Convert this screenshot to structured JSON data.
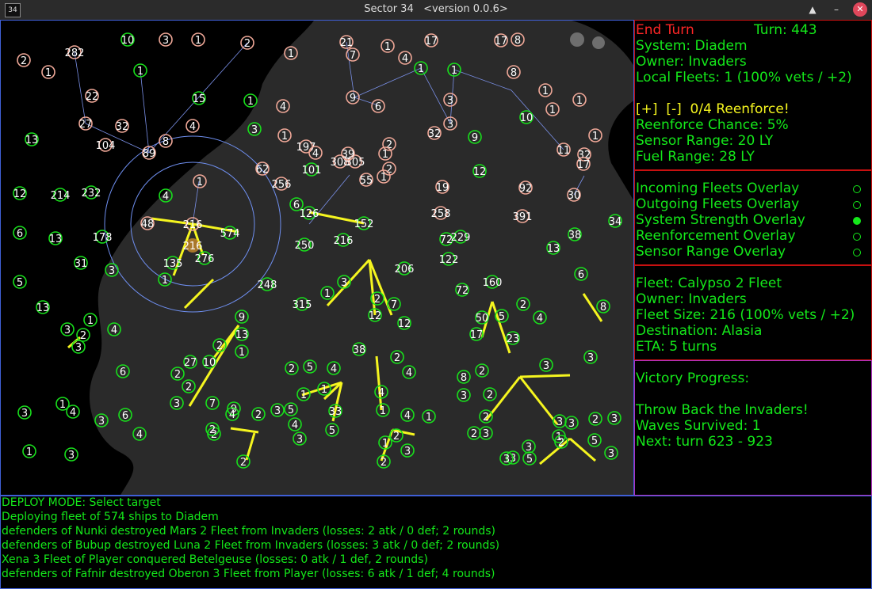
{
  "window": {
    "app_icon": "34",
    "title": "Sector 34",
    "version": "<version 0.0.6>",
    "controls": [
      "restore-icon",
      "minimize-icon",
      "close-icon"
    ]
  },
  "colors": {
    "enemy": "#f0a898",
    "player": "#18e01c",
    "fleet": "#f5f51f",
    "ring": "#6f8ff0",
    "panel_border": "#c81010",
    "text": "#14e81a"
  },
  "stars": [
    {
      "label": "10",
      "side": "player"
    },
    {
      "label": "3",
      "side": "enemy"
    },
    {
      "label": "1",
      "side": "enemy"
    },
    {
      "label": "2",
      "side": "enemy"
    },
    {
      "label": "1",
      "side": "enemy"
    },
    {
      "label": "2",
      "side": "enemy"
    },
    {
      "label": "1",
      "side": "enemy"
    },
    {
      "label": "282",
      "side": "enemy"
    },
    {
      "label": "1",
      "side": "player"
    },
    {
      "label": "21",
      "side": "enemy"
    },
    {
      "label": "1",
      "side": "enemy"
    },
    {
      "label": "17",
      "side": "enemy"
    },
    {
      "label": "1",
      "side": "player"
    },
    {
      "label": "17",
      "side": "enemy"
    },
    {
      "label": "8",
      "side": "enemy"
    },
    {
      "label": "7",
      "side": "enemy"
    },
    {
      "label": "4",
      "side": "enemy"
    },
    {
      "label": "1",
      "side": "player"
    },
    {
      "label": "8",
      "side": "enemy"
    },
    {
      "label": "3",
      "side": "enemy"
    },
    {
      "label": "1",
      "side": "enemy"
    },
    {
      "label": "22",
      "side": "enemy"
    },
    {
      "label": "15",
      "side": "player"
    },
    {
      "label": "1",
      "side": "player"
    },
    {
      "label": "4",
      "side": "enemy"
    },
    {
      "label": "6",
      "side": "enemy"
    },
    {
      "label": "9",
      "side": "enemy"
    },
    {
      "label": "3",
      "side": "enemy"
    },
    {
      "label": "1",
      "side": "enemy"
    },
    {
      "label": "1",
      "side": "enemy"
    },
    {
      "label": "27",
      "side": "enemy"
    },
    {
      "label": "32",
      "side": "enemy"
    },
    {
      "label": "4",
      "side": "enemy"
    },
    {
      "label": "3",
      "side": "player"
    },
    {
      "label": "1",
      "side": "enemy"
    },
    {
      "label": "2",
      "side": "enemy"
    },
    {
      "label": "32",
      "side": "enemy"
    },
    {
      "label": "9",
      "side": "player"
    },
    {
      "label": "10",
      "side": "player"
    },
    {
      "label": "11",
      "side": "enemy"
    },
    {
      "label": "1",
      "side": "enemy"
    },
    {
      "label": "13",
      "side": "player"
    },
    {
      "label": "104",
      "side": "enemy"
    },
    {
      "label": "89",
      "side": "enemy"
    },
    {
      "label": "8",
      "side": "enemy"
    },
    {
      "label": "197",
      "side": "enemy"
    },
    {
      "label": "4",
      "side": "enemy"
    },
    {
      "label": "1",
      "side": "enemy"
    },
    {
      "label": "2",
      "side": "enemy"
    },
    {
      "label": "1",
      "side": "enemy"
    },
    {
      "label": "32",
      "side": "enemy"
    },
    {
      "label": "17",
      "side": "enemy"
    },
    {
      "label": "62",
      "side": "enemy"
    },
    {
      "label": "308",
      "side": "enemy"
    },
    {
      "label": "305",
      "side": "enemy"
    },
    {
      "label": "39",
      "side": "enemy"
    },
    {
      "label": "101",
      "side": "player"
    },
    {
      "label": "55",
      "side": "enemy"
    },
    {
      "label": "12",
      "side": "player"
    },
    {
      "label": "1",
      "side": "enemy"
    },
    {
      "label": "256",
      "side": "enemy"
    },
    {
      "label": "19",
      "side": "enemy"
    },
    {
      "label": "92",
      "side": "enemy"
    },
    {
      "label": "30",
      "side": "enemy"
    },
    {
      "label": "12",
      "side": "player"
    },
    {
      "label": "214",
      "side": "player"
    },
    {
      "label": "232",
      "side": "player"
    },
    {
      "label": "4",
      "side": "player"
    },
    {
      "label": "6",
      "side": "player"
    },
    {
      "label": "126",
      "side": "player"
    },
    {
      "label": "258",
      "side": "enemy"
    },
    {
      "label": "391",
      "side": "enemy"
    },
    {
      "label": "34",
      "side": "player"
    },
    {
      "label": "6",
      "side": "player"
    },
    {
      "label": "13",
      "side": "player"
    },
    {
      "label": "178",
      "side": "player"
    },
    {
      "label": "48",
      "side": "enemy"
    },
    {
      "label": "216",
      "side": "enemy"
    },
    {
      "label": "574",
      "side": "player"
    },
    {
      "label": "152",
      "side": "player"
    },
    {
      "label": "216",
      "side": "player"
    },
    {
      "label": "72",
      "side": "player"
    },
    {
      "label": "229",
      "side": "player"
    },
    {
      "label": "38",
      "side": "player"
    },
    {
      "label": "250",
      "side": "player"
    },
    {
      "label": "13",
      "side": "player"
    },
    {
      "label": "31",
      "side": "player"
    },
    {
      "label": "135",
      "side": "player"
    },
    {
      "label": "276",
      "side": "player"
    },
    {
      "label": "122",
      "side": "player"
    },
    {
      "label": "5",
      "side": "player"
    },
    {
      "label": "1",
      "side": "player"
    },
    {
      "label": "3",
      "side": "player"
    },
    {
      "label": "248",
      "side": "player"
    },
    {
      "label": "206",
      "side": "player"
    },
    {
      "label": "13",
      "side": "player"
    },
    {
      "label": "6",
      "side": "player"
    },
    {
      "label": "72",
      "side": "player"
    },
    {
      "label": "160",
      "side": "player"
    },
    {
      "label": "315",
      "side": "player"
    },
    {
      "label": "2",
      "side": "player"
    },
    {
      "label": "1",
      "side": "player"
    },
    {
      "label": "3",
      "side": "player"
    },
    {
      "label": "7",
      "side": "player"
    },
    {
      "label": "2",
      "side": "player"
    },
    {
      "label": "8",
      "side": "player"
    },
    {
      "label": "50",
      "side": "player"
    },
    {
      "label": "5",
      "side": "player"
    },
    {
      "label": "4",
      "side": "player"
    },
    {
      "label": "3",
      "side": "player"
    },
    {
      "label": "1",
      "side": "player"
    },
    {
      "label": "2",
      "side": "player"
    },
    {
      "label": "4",
      "side": "player"
    },
    {
      "label": "3",
      "side": "player"
    },
    {
      "label": "9",
      "side": "player"
    },
    {
      "label": "13",
      "side": "player"
    },
    {
      "label": "12",
      "side": "player"
    },
    {
      "label": "12",
      "side": "player"
    },
    {
      "label": "23",
      "side": "player"
    },
    {
      "label": "17",
      "side": "player"
    },
    {
      "label": "1",
      "side": "player"
    },
    {
      "label": "38",
      "side": "player"
    },
    {
      "label": "2",
      "side": "player"
    },
    {
      "label": "2",
      "side": "player"
    },
    {
      "label": "10",
      "side": "player"
    },
    {
      "label": "27",
      "side": "player"
    },
    {
      "label": "2",
      "side": "player"
    },
    {
      "label": "5",
      "side": "player"
    },
    {
      "label": "2",
      "side": "player"
    },
    {
      "label": "4",
      "side": "player"
    },
    {
      "label": "8",
      "side": "player"
    },
    {
      "label": "2",
      "side": "player"
    },
    {
      "label": "33",
      "side": "player"
    },
    {
      "label": "3",
      "side": "player"
    },
    {
      "label": "3",
      "side": "player"
    },
    {
      "label": "4",
      "side": "player"
    },
    {
      "label": "6",
      "side": "player"
    },
    {
      "label": "2",
      "side": "player"
    },
    {
      "label": "3",
      "side": "player"
    },
    {
      "label": "4",
      "side": "player"
    },
    {
      "label": "7",
      "side": "player"
    },
    {
      "label": "1",
      "side": "player"
    },
    {
      "label": "2",
      "side": "player"
    },
    {
      "label": "3",
      "side": "player"
    },
    {
      "label": "1",
      "side": "player"
    },
    {
      "label": "9",
      "side": "player"
    },
    {
      "label": "3",
      "side": "player"
    },
    {
      "label": "5",
      "side": "player"
    },
    {
      "label": "2",
      "side": "player"
    },
    {
      "label": "4",
      "side": "player"
    },
    {
      "label": "1",
      "side": "player"
    },
    {
      "label": "3",
      "side": "player"
    },
    {
      "label": "1",
      "side": "player"
    },
    {
      "label": "4",
      "side": "player"
    },
    {
      "label": "3",
      "side": "player"
    },
    {
      "label": "6",
      "side": "player"
    },
    {
      "label": "2",
      "side": "player"
    },
    {
      "label": "4",
      "side": "player"
    },
    {
      "label": "4",
      "side": "player"
    },
    {
      "label": "1",
      "side": "player"
    },
    {
      "label": "2",
      "side": "player"
    },
    {
      "label": "2",
      "side": "player"
    },
    {
      "label": "3",
      "side": "player"
    },
    {
      "label": "1",
      "side": "player"
    },
    {
      "label": "3",
      "side": "player"
    },
    {
      "label": "2",
      "side": "player"
    },
    {
      "label": "3",
      "side": "player"
    },
    {
      "label": "4",
      "side": "player"
    },
    {
      "label": "2",
      "side": "player"
    },
    {
      "label": "3",
      "side": "player"
    },
    {
      "label": "5",
      "side": "player"
    },
    {
      "label": "1",
      "side": "player"
    },
    {
      "label": "2",
      "side": "player"
    },
    {
      "label": "3",
      "side": "player"
    },
    {
      "label": "1",
      "side": "player"
    },
    {
      "label": "3",
      "side": "player"
    },
    {
      "label": "2",
      "side": "player"
    },
    {
      "label": "2",
      "side": "player"
    },
    {
      "label": "3",
      "side": "player"
    },
    {
      "label": "3",
      "side": "player"
    },
    {
      "label": "3",
      "side": "player"
    },
    {
      "label": "2",
      "side": "player"
    },
    {
      "label": "5",
      "side": "player"
    },
    {
      "label": "3",
      "side": "player"
    },
    {
      "label": "3",
      "side": "player"
    },
    {
      "label": "5",
      "side": "player"
    },
    {
      "label": "5",
      "side": "player"
    },
    {
      "label": "2",
      "side": "player"
    },
    {
      "label": "2",
      "side": "player"
    }
  ],
  "panel_system": {
    "end_turn": "End Turn",
    "turn": "Turn: 443",
    "system": "System: Diadem",
    "owner": "Owner: Invaders",
    "local_fleets": "Local Fleets: 1 (100% vets / +2)",
    "plus": "[+]",
    "minus": "[-]",
    "reenforce": "0/4 Reenforce!",
    "reenforce_chance": "Reenforce Chance: 5%",
    "sensor_range": "Sensor Range: 20 LY",
    "fuel_range": "Fuel Range: 28 LY"
  },
  "overlays": [
    {
      "label": "Incoming Fleets Overlay",
      "on": false
    },
    {
      "label": "Outgoing Fleets Overlay",
      "on": false
    },
    {
      "label": "System Strength Overlay",
      "on": true
    },
    {
      "label": "Reenforcement Overlay",
      "on": false
    },
    {
      "label": "Sensor Range Overlay",
      "on": false
    }
  ],
  "fleet": {
    "name": "Fleet: Calypso 2 Fleet",
    "owner": "Owner: Invaders",
    "size": "Fleet Size: 216 (100% vets / +2)",
    "destination": "Destination: Alasia",
    "eta": "ETA: 5 turns"
  },
  "victory": {
    "heading": "Victory Progress:",
    "goal": "Throw Back the Invaders!",
    "waves": "Waves Survived: 1",
    "next": "Next: turn 623 - 923"
  },
  "log": [
    "DEPLOY MODE: Select target",
    "Deploying fleet of 574 ships to Diadem",
    "defenders of Nunki destroyed Mars 2 Fleet from Invaders (losses: 2 atk / 0 def; 2 rounds)",
    "defenders of Bubup destroyed Luna 2 Fleet from Invaders (losses: 3 atk / 0 def; 2 rounds)",
    "Xena 3 Fleet of Player conquered Betelgeuse (losses: 0 atk / 1 def, 2 rounds)",
    "defenders of Fafnir destroyed Oberon 3 Fleet from Player (losses: 6 atk / 1 def; 4 rounds)"
  ]
}
